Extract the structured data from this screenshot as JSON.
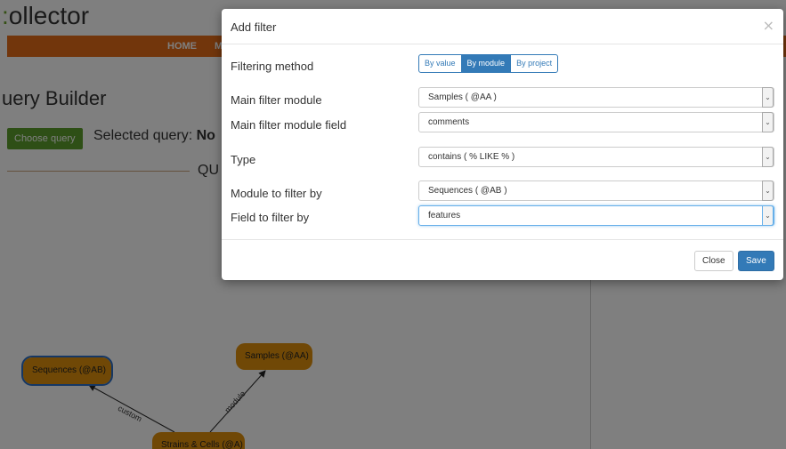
{
  "app": {
    "logo_text": "ollector",
    "logo_dot": ":",
    "nav": {
      "home": "HOME",
      "next": "M"
    },
    "page_heading": "uery Builder",
    "choose_query_label": "Choose query",
    "selected_query_prefix": "Selected query: ",
    "selected_query_value": "No",
    "section_title": "QU",
    "graph": {
      "nodes": [
        {
          "label": "Sequences (@AB)"
        },
        {
          "label": "Samples (@AA)"
        },
        {
          "label": "Strains & Cells (@A)"
        }
      ],
      "edges": [
        {
          "label": "custom"
        },
        {
          "label": "module"
        }
      ]
    }
  },
  "modal": {
    "title": "Add filter",
    "close_icon": "×",
    "filtering_method": {
      "label": "Filtering method",
      "options": [
        "By value",
        "By module",
        "By project"
      ],
      "selected": "By module"
    },
    "main_filter_module": {
      "label": "Main filter module",
      "value": "Samples ( @AA )"
    },
    "main_filter_module_field": {
      "label": "Main filter module field",
      "value": "comments"
    },
    "type": {
      "label": "Type",
      "value": "contains ( % LIKE % )"
    },
    "module_to_filter_by": {
      "label": "Module to filter by",
      "value": "Sequences ( @AB )"
    },
    "field_to_filter_by": {
      "label": "Field to filter by",
      "value": "features"
    },
    "footer": {
      "close_label": "Close",
      "save_label": "Save"
    },
    "dropdown_icon": "chevron-down-icon"
  },
  "colors": {
    "nav_orange": "#e56d18",
    "node_orange": "#e0900c",
    "primary_blue": "#337ab7",
    "choose_green": "#5c9e2c"
  }
}
